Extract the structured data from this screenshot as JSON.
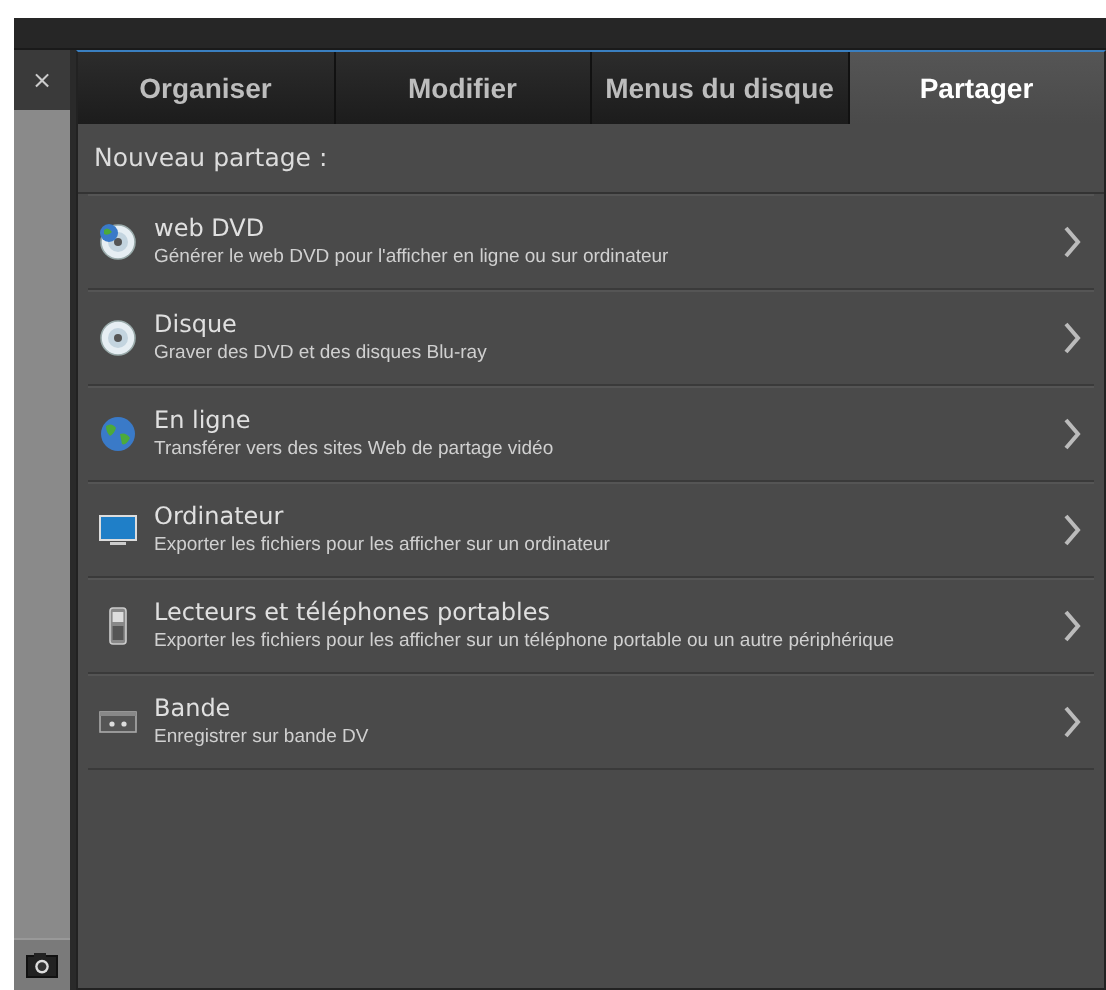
{
  "sidebar": {
    "close": "×"
  },
  "tabs": [
    {
      "label": "Organiser",
      "selected": false
    },
    {
      "label": "Modifier",
      "selected": false
    },
    {
      "label": "Menus du disque",
      "selected": false
    },
    {
      "label": "Partager",
      "selected": true
    }
  ],
  "section_title": "Nouveau partage :",
  "items": [
    {
      "kind": "webdvd",
      "title": "web DVD",
      "description": "Générer le web DVD pour l'afficher en ligne ou sur ordinateur"
    },
    {
      "kind": "disc",
      "title": "Disque",
      "description": "Graver des DVD et des disques Blu-ray"
    },
    {
      "kind": "globe",
      "title": "En ligne",
      "description": "Transférer vers des sites Web de partage vidéo"
    },
    {
      "kind": "monitor",
      "title": "Ordinateur",
      "description": "Exporter les fichiers pour les afficher sur un ordinateur"
    },
    {
      "kind": "phone",
      "title": "Lecteurs et téléphones portables",
      "description": "Exporter les fichiers pour les afficher sur un téléphone portable ou un autre périphérique"
    },
    {
      "kind": "tape",
      "title": "Bande",
      "description": "Enregistrer sur bande DV"
    }
  ]
}
